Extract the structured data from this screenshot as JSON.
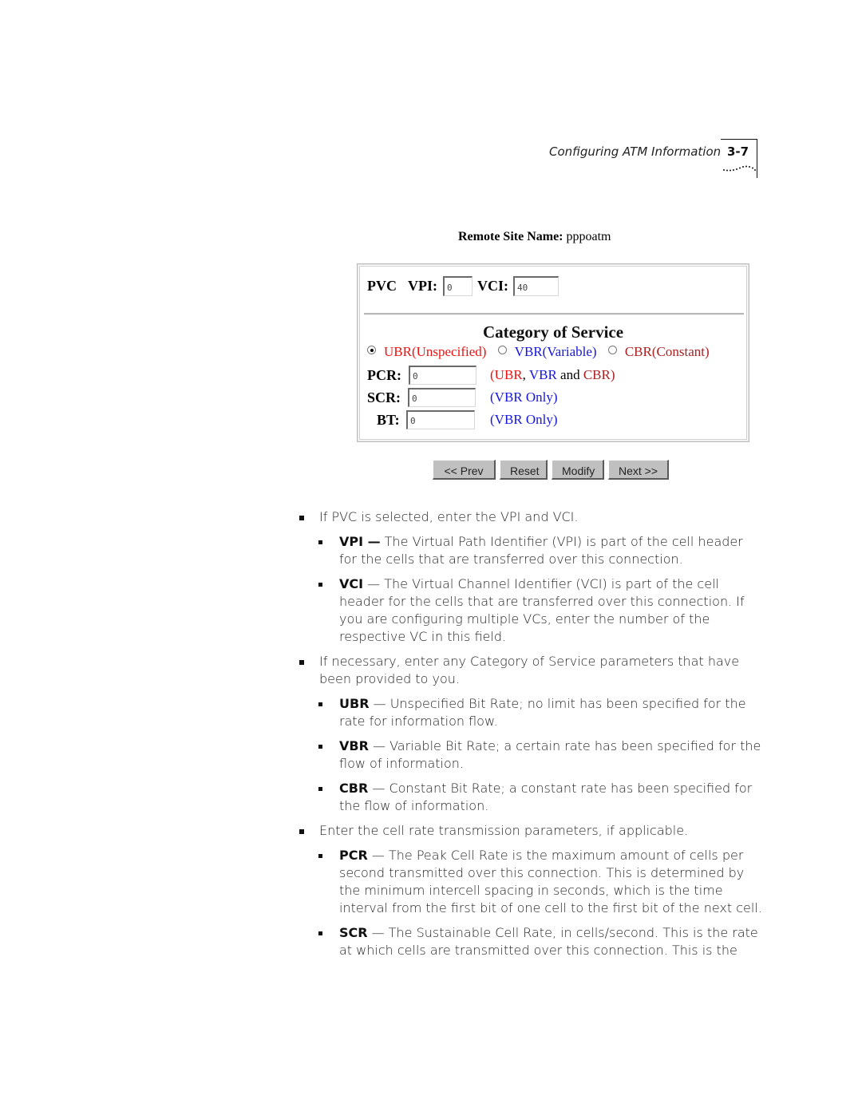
{
  "header": {
    "running_title": "Configuring ATM Information",
    "page_number": "3-7"
  },
  "form": {
    "site_name_label": "Remote Site Name:",
    "site_name_value": "pppoatm",
    "pvc_label": "PVC",
    "vpi_label": "VPI:",
    "vpi_value": "0",
    "vci_label": "VCI:",
    "vci_value": "40",
    "category_title": "Category of Service",
    "service_options": [
      {
        "label": "UBR(Unspecified)",
        "selected": true,
        "color": "#ee1111"
      },
      {
        "label": "VBR(Variable)",
        "selected": false,
        "color": "#1515dd"
      },
      {
        "label": "CBR(Constant)",
        "selected": false,
        "color": "#aa2222"
      }
    ],
    "pcr_label": "PCR:",
    "pcr_value": "0",
    "pcr_note": {
      "ubr": "(UBR",
      "comma": ",",
      "vbr": "VBR",
      "and": "and",
      "cbr": "CBR)"
    },
    "scr_label": "SCR:",
    "scr_value": "0",
    "scr_note": "(VBR Only)",
    "bt_label": "BT:",
    "bt_value": "0",
    "bt_note": "(VBR Only)",
    "buttons": {
      "prev": "<< Prev",
      "reset": "Reset",
      "modify": "Modify",
      "next": "Next >>"
    }
  },
  "body": {
    "items": [
      {
        "text": "If PVC is selected, enter the VPI and VCI."
      },
      {
        "term": "VPI —",
        "text": " The Virtual Path Identifier (VPI) is part of the cell header for the cells that are transferred over this connection."
      },
      {
        "term": "VCI",
        "text": " — The Virtual Channel Identifier (VCI) is part of the cell header for the cells that are transferred over this connection. If you are configuring multiple VCs, enter the number of the respective VC in this field."
      },
      {
        "text": "If necessary, enter any Category of Service parameters that have been provided to you."
      },
      {
        "term": "UBR",
        "text": " — Unspecified Bit Rate; no limit has been specified for the rate for information flow."
      },
      {
        "term": "VBR",
        "text": " — Variable Bit Rate; a certain rate has been specified for the flow of information."
      },
      {
        "term": "CBR",
        "text": " — Constant Bit Rate; a constant rate has been specified for the flow of information."
      },
      {
        "text": "Enter the cell rate transmission parameters, if applicable."
      },
      {
        "term": "PCR",
        "text": " — The Peak Cell Rate is the maximum amount of cells per second transmitted over this connection. This is determined by the minimum intercell spacing in seconds, which is the time interval from the first bit of one cell to the first bit of the next cell."
      },
      {
        "term": "SCR",
        "text": " — The Sustainable Cell Rate, in cells/second. This is the rate at which cells are transmitted over this connection. This is the"
      }
    ]
  }
}
